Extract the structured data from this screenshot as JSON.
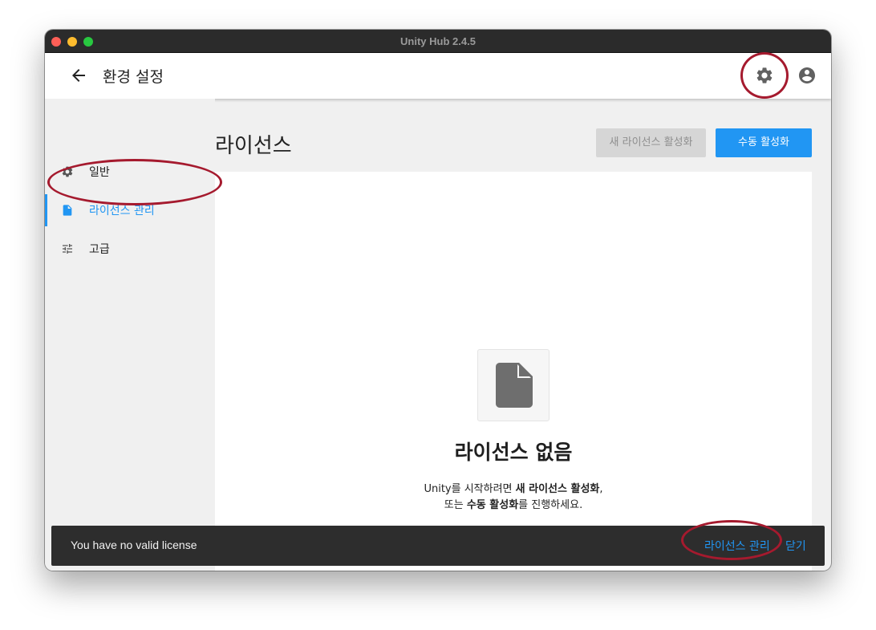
{
  "window": {
    "title": "Unity Hub 2.4.5"
  },
  "header": {
    "title": "환경 설정",
    "back_icon": "arrow-left-icon",
    "settings_icon": "gear-icon",
    "account_icon": "account-circle-icon"
  },
  "sidebar": {
    "items": [
      {
        "label": "일반",
        "icon": "gear-icon",
        "active": false
      },
      {
        "label": "라이선스 관리",
        "icon": "document-icon",
        "active": true
      },
      {
        "label": "고급",
        "icon": "sliders-icon",
        "active": false
      }
    ]
  },
  "main": {
    "title": "라이선스",
    "new_license_button": "새 라이선스 활성화",
    "manual_activation_button": "수동 활성화",
    "empty_state": {
      "icon": "document-icon",
      "title": "라이선스 없음",
      "line1_part1": "Unity를 시작하려면 ",
      "line1_bold": "새 라이선스 활성화",
      "line1_part2": ",",
      "line2_part1": "또는 ",
      "line2_bold": "수동 활성화",
      "line2_part2": "를 진행하세요."
    }
  },
  "snackbar": {
    "message": "You have no valid license",
    "manage_link": "라이선스 관리",
    "close_link": "닫기"
  },
  "colors": {
    "accent": "#2196f3",
    "highlight": "#a51a2e",
    "snackbar_bg": "#2d2d2d",
    "disabled_button": "#d6d6d6"
  }
}
